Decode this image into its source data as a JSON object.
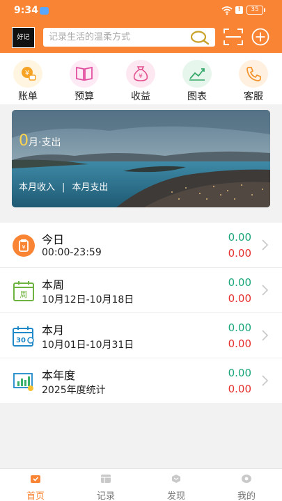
{
  "status_bar": {
    "time": "9:34",
    "battery": "35"
  },
  "header": {
    "logo_text": "好记",
    "search_placeholder": "记录生活的温柔方式"
  },
  "quick_nav": [
    {
      "label": "账单",
      "icon": "bill-coin-icon",
      "color": "#f7a323"
    },
    {
      "label": "预算",
      "icon": "budget-book-icon",
      "color": "#e24fa0"
    },
    {
      "label": "收益",
      "icon": "money-bag-icon",
      "color": "#e3508f"
    },
    {
      "label": "图表",
      "icon": "trend-chart-icon",
      "color": "#37a86a"
    },
    {
      "label": "客服",
      "icon": "phone-icon",
      "color": "#f3932b"
    }
  ],
  "banner": {
    "month_num": "0",
    "month_text": "月·支出",
    "income_link": "本月收入",
    "separator": "|",
    "expense_link": "本月支出"
  },
  "periods": [
    {
      "title": "今日",
      "range": "00:00-23:59",
      "income": "0.00",
      "expense": "0.00",
      "icon": "today-calendar-icon"
    },
    {
      "title": "本周",
      "range": "10月12日-10月18日",
      "income": "0.00",
      "expense": "0.00",
      "icon": "week-calendar-icon"
    },
    {
      "title": "本月",
      "range": "10月01日-10月31日",
      "income": "0.00",
      "expense": "0.00",
      "icon": "month-calendar-icon"
    },
    {
      "title": "本年度",
      "range": "2025年度统计",
      "income": "0.00",
      "expense": "0.00",
      "icon": "year-chart-icon"
    }
  ],
  "tabs": [
    {
      "label": "首页",
      "icon": "home-icon",
      "active": true
    },
    {
      "label": "记录",
      "icon": "record-icon",
      "active": false
    },
    {
      "label": "发现",
      "icon": "discover-icon",
      "active": false
    },
    {
      "label": "我的",
      "icon": "profile-icon",
      "active": false
    }
  ],
  "colors": {
    "brand": "#f98433",
    "income": "#1aa67a",
    "expense": "#e5322e"
  }
}
